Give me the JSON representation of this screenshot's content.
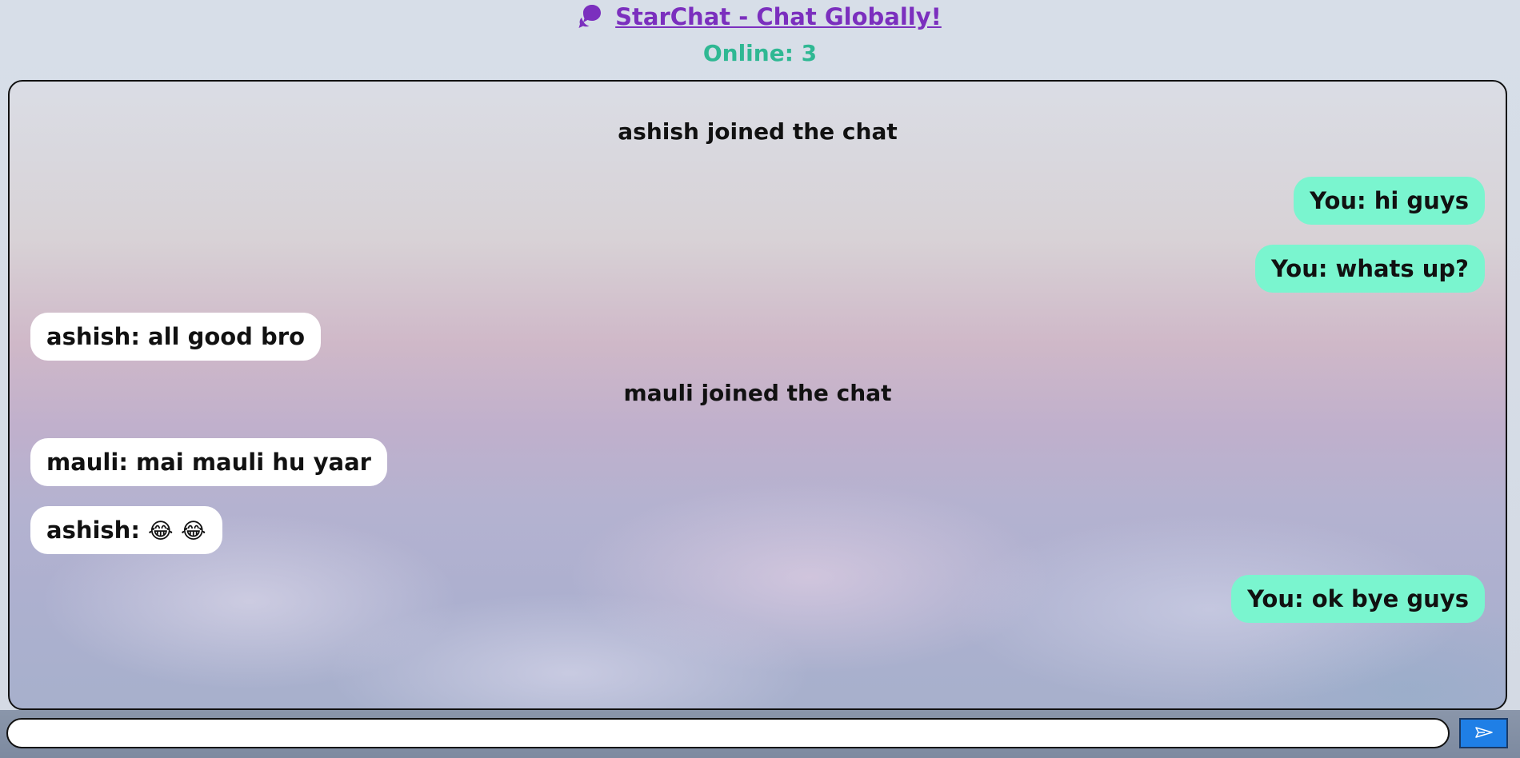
{
  "header": {
    "title": "StarChat - Chat Globally!",
    "online_label": "Online: 3",
    "icon": "chat-bubbles-icon",
    "title_color": "#7b2fbe",
    "online_color": "#2fb893"
  },
  "chat": {
    "messages": [
      {
        "kind": "system",
        "text": "ashish joined the chat"
      },
      {
        "kind": "outgoing",
        "text": "You: hi guys"
      },
      {
        "kind": "outgoing",
        "text": "You: whats up?"
      },
      {
        "kind": "incoming",
        "text": "ashish: all good bro"
      },
      {
        "kind": "system",
        "text": "mauli joined the chat"
      },
      {
        "kind": "incoming",
        "text": "mauli: mai mauli hu yaar"
      },
      {
        "kind": "incoming",
        "text": "ashish:",
        "emoji": "😂 😂"
      },
      {
        "kind": "outgoing",
        "text": "You: ok bye guys"
      }
    ],
    "outgoing_color": "#7af5cf",
    "incoming_color": "#ffffff"
  },
  "composer": {
    "input_value": "",
    "input_placeholder": "",
    "send_icon": "send-arrow-icon",
    "send_color": "#1f7fe6"
  }
}
